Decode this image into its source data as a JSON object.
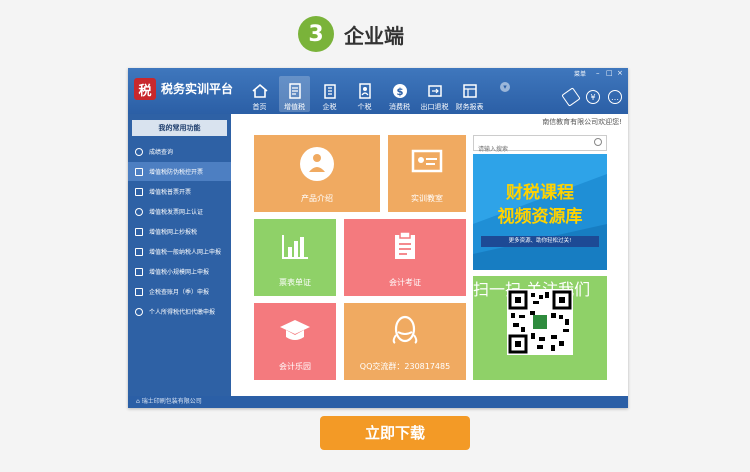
{
  "step": {
    "number": "3",
    "title": "企业端"
  },
  "app": {
    "logo_char": "税",
    "title": "税务实训平台",
    "menu_label": "菜单",
    "welcome": "南信教育有限公司欢迎您!",
    "status": "瑞士印刷包装有限公司",
    "nav": [
      {
        "label": "首页",
        "icon": "home-icon"
      },
      {
        "label": "增值税",
        "icon": "document-icon"
      },
      {
        "label": "企税",
        "icon": "building-icon"
      },
      {
        "label": "个税",
        "icon": "person-doc-icon"
      },
      {
        "label": "消费税",
        "icon": "coin-icon"
      },
      {
        "label": "出口退税",
        "icon": "export-icon"
      },
      {
        "label": "财务报表",
        "icon": "report-icon"
      }
    ],
    "sidebar": {
      "header": "我的常用功能",
      "items": [
        {
          "label": "成绩查询",
          "icon": "search-icon"
        },
        {
          "label": "增值税防伪税控开票",
          "icon": "invoice-icon"
        },
        {
          "label": "增值税普票开票",
          "icon": "invoice-icon"
        },
        {
          "label": "增值税发票网上认证",
          "icon": "check-icon"
        },
        {
          "label": "增值税网上抄报税",
          "icon": "edit-icon"
        },
        {
          "label": "增值税一般纳税人网上申报",
          "icon": "form-icon"
        },
        {
          "label": "增值税小规模网上申报",
          "icon": "form-icon"
        },
        {
          "label": "企税查账月（季）申报",
          "icon": "lock-icon"
        },
        {
          "label": "个人所得税代扣代缴申报",
          "icon": "person-icon"
        }
      ]
    },
    "tiles": {
      "product": "产品介绍",
      "classroom": "实训教室",
      "tax_check": "票表单证",
      "exam": "会计考证",
      "park": "会计乐园",
      "qq": "QQ交流群：230817485"
    },
    "search_placeholder": "请输入搜索",
    "banner": {
      "line1": "财税课程",
      "line2": "视频资源库",
      "tagline": "更多资源、助你轻松过关!"
    },
    "qr_label": "扫一扫 关注我们"
  },
  "download_label": "立即下载",
  "colors": {
    "step_green": "#7ab33a",
    "orange": "#f0aa61",
    "green": "#8fd168",
    "pink": "#f47a7e",
    "cta": "#f39a26"
  }
}
